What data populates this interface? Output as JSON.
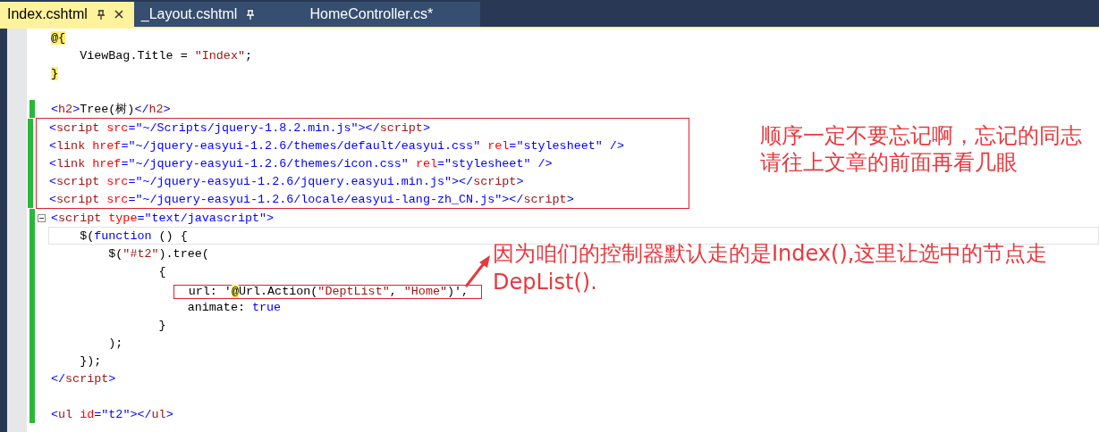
{
  "tabs": [
    {
      "label": "Index.cshtml",
      "selected": true,
      "pinned": true
    },
    {
      "label": "_Layout.cshtml",
      "selected": false,
      "pinned": true
    },
    {
      "label": "HomeController.cs*",
      "selected": false,
      "pinned": false
    }
  ],
  "sections": [
    {
      "boxed": false,
      "lines": [
        {
          "kind": "code",
          "changed": false,
          "current": false,
          "marked": false,
          "tokens": [
            {
              "kind": "razor",
              "text": "@{"
            }
          ]
        },
        {
          "kind": "code",
          "changed": false,
          "current": false,
          "marked": false,
          "tokens": [
            {
              "kind": "plain",
              "text": "    ViewBag.Title = "
            },
            {
              "kind": "string",
              "text": "\"Index\""
            },
            {
              "kind": "plain",
              "text": ";"
            }
          ]
        },
        {
          "kind": "code",
          "changed": false,
          "current": false,
          "marked": false,
          "tokens": [
            {
              "kind": "razor",
              "text": "}"
            }
          ]
        },
        {
          "kind": "blank",
          "changed": false,
          "current": false,
          "marked": false
        },
        {
          "kind": "code",
          "changed": true,
          "current": false,
          "marked": false,
          "tokens": [
            {
              "kind": "delim",
              "text": "<"
            },
            {
              "kind": "tag",
              "text": "h2"
            },
            {
              "kind": "delim",
              "text": ">"
            },
            {
              "kind": "plain",
              "text": "Tree(树)"
            },
            {
              "kind": "delim",
              "text": "</"
            },
            {
              "kind": "tag",
              "text": "h2"
            },
            {
              "kind": "delim",
              "text": ">"
            }
          ]
        }
      ]
    },
    {
      "boxed": true,
      "lines": [
        {
          "kind": "code",
          "changed": true,
          "current": false,
          "marked": false,
          "tokens": [
            {
              "kind": "delim",
              "text": "<"
            },
            {
              "kind": "tag",
              "text": "script"
            },
            {
              "kind": "attr",
              "text": " src"
            },
            {
              "kind": "delim",
              "text": "="
            },
            {
              "kind": "value",
              "text": "\"~/Scripts/jquery-1.8.2.min.js\""
            },
            {
              "kind": "delim",
              "text": "></"
            },
            {
              "kind": "tag",
              "text": "script"
            },
            {
              "kind": "delim",
              "text": ">"
            }
          ]
        },
        {
          "kind": "code",
          "changed": true,
          "current": false,
          "marked": false,
          "tokens": [
            {
              "kind": "delim",
              "text": "<"
            },
            {
              "kind": "tag",
              "text": "link"
            },
            {
              "kind": "attr",
              "text": " href"
            },
            {
              "kind": "delim",
              "text": "="
            },
            {
              "kind": "value",
              "text": "\"~/jquery-easyui-1.2.6/themes/default/easyui.css\""
            },
            {
              "kind": "attr",
              "text": " rel"
            },
            {
              "kind": "delim",
              "text": "="
            },
            {
              "kind": "value",
              "text": "\"stylesheet\""
            },
            {
              "kind": "delim",
              "text": " />"
            }
          ]
        },
        {
          "kind": "code",
          "changed": true,
          "current": false,
          "marked": false,
          "tokens": [
            {
              "kind": "delim",
              "text": "<"
            },
            {
              "kind": "tag",
              "text": "link"
            },
            {
              "kind": "attr",
              "text": " href"
            },
            {
              "kind": "delim",
              "text": "="
            },
            {
              "kind": "value",
              "text": "\"~/jquery-easyui-1.2.6/themes/icon.css\""
            },
            {
              "kind": "attr",
              "text": " rel"
            },
            {
              "kind": "delim",
              "text": "="
            },
            {
              "kind": "value",
              "text": "\"stylesheet\""
            },
            {
              "kind": "delim",
              "text": " />"
            }
          ]
        },
        {
          "kind": "code",
          "changed": true,
          "current": false,
          "marked": false,
          "tokens": [
            {
              "kind": "delim",
              "text": "<"
            },
            {
              "kind": "tag",
              "text": "script"
            },
            {
              "kind": "attr",
              "text": " src"
            },
            {
              "kind": "delim",
              "text": "="
            },
            {
              "kind": "value",
              "text": "\"~/jquery-easyui-1.2.6/jquery.easyui.min.js\""
            },
            {
              "kind": "delim",
              "text": "></"
            },
            {
              "kind": "tag",
              "text": "script"
            },
            {
              "kind": "delim",
              "text": ">"
            }
          ]
        },
        {
          "kind": "code",
          "changed": true,
          "current": false,
          "marked": false,
          "tokens": [
            {
              "kind": "delim",
              "text": "<"
            },
            {
              "kind": "tag",
              "text": "script"
            },
            {
              "kind": "attr",
              "text": " src"
            },
            {
              "kind": "delim",
              "text": "="
            },
            {
              "kind": "value",
              "text": "\"~/jquery-easyui-1.2.6/locale/easyui-lang-zh_CN.js\""
            },
            {
              "kind": "delim",
              "text": "></"
            },
            {
              "kind": "tag",
              "text": "script"
            },
            {
              "kind": "delim",
              "text": ">"
            }
          ]
        }
      ]
    },
    {
      "boxed": false,
      "lines": [
        {
          "kind": "fold",
          "changed": true,
          "current": false,
          "marked": false,
          "tokens": [
            {
              "kind": "delim",
              "text": "<"
            },
            {
              "kind": "tag",
              "text": "script"
            },
            {
              "kind": "attr",
              "text": " type"
            },
            {
              "kind": "delim",
              "text": "="
            },
            {
              "kind": "value",
              "text": "\"text/javascript\""
            },
            {
              "kind": "delim",
              "text": ">"
            }
          ]
        },
        {
          "kind": "code",
          "changed": true,
          "current": true,
          "marked": false,
          "tokens": [
            {
              "kind": "plain",
              "text": "    $("
            },
            {
              "kind": "keyword",
              "text": "function"
            },
            {
              "kind": "plain",
              "text": " () {"
            }
          ]
        },
        {
          "kind": "code",
          "changed": true,
          "current": false,
          "marked": false,
          "tokens": [
            {
              "kind": "plain",
              "text": "        $("
            },
            {
              "kind": "string",
              "text": "\"#t2\""
            },
            {
              "kind": "plain",
              "text": ").tree("
            }
          ]
        },
        {
          "kind": "code",
          "changed": true,
          "current": false,
          "marked": false,
          "tokens": [
            {
              "kind": "plain",
              "text": "               {"
            }
          ]
        },
        {
          "kind": "framed",
          "changed": true,
          "current": false,
          "marked": true,
          "tokens": [
            {
              "kind": "plain",
              "text": "  url: '"
            },
            {
              "kind": "razor",
              "text": "@"
            },
            {
              "kind": "plain",
              "text": "Url.Action("
            },
            {
              "kind": "string",
              "text": "\"DeptList\""
            },
            {
              "kind": "plain",
              "text": ", "
            },
            {
              "kind": "string",
              "text": "\"Home\""
            },
            {
              "kind": "plain",
              "text": ")',"
            }
          ]
        },
        {
          "kind": "code",
          "changed": true,
          "current": false,
          "marked": false,
          "tokens": [
            {
              "kind": "plain",
              "text": "                   animate: "
            },
            {
              "kind": "keyword",
              "text": "true"
            }
          ]
        },
        {
          "kind": "code",
          "changed": true,
          "current": false,
          "marked": false,
          "tokens": [
            {
              "kind": "plain",
              "text": "               }"
            }
          ]
        },
        {
          "kind": "code",
          "changed": true,
          "current": false,
          "marked": false,
          "tokens": [
            {
              "kind": "plain",
              "text": "        );"
            }
          ]
        },
        {
          "kind": "code",
          "changed": true,
          "current": false,
          "marked": false,
          "tokens": [
            {
              "kind": "plain",
              "text": "    });"
            }
          ]
        },
        {
          "kind": "code",
          "changed": true,
          "current": false,
          "marked": false,
          "tokens": [
            {
              "kind": "delim",
              "text": "</"
            },
            {
              "kind": "tag",
              "text": "script"
            },
            {
              "kind": "delim",
              "text": ">"
            }
          ]
        },
        {
          "kind": "blank",
          "changed": true,
          "current": false,
          "marked": false
        },
        {
          "kind": "code",
          "changed": true,
          "current": false,
          "marked": false,
          "tokens": [
            {
              "kind": "delim",
              "text": "<"
            },
            {
              "kind": "tag",
              "text": "ul"
            },
            {
              "kind": "attr",
              "text": " id"
            },
            {
              "kind": "delim",
              "text": "="
            },
            {
              "kind": "value",
              "text": "\"t2\""
            },
            {
              "kind": "delim",
              "text": "></"
            },
            {
              "kind": "tag",
              "text": "ul"
            },
            {
              "kind": "delim",
              "text": ">"
            }
          ]
        }
      ]
    }
  ],
  "notes": [
    {
      "kind": "order",
      "text": "顺序一定不要忘记啊，忘记的同志请往上文章的前面再看几眼"
    },
    {
      "kind": "controller",
      "text": "因为咱们的控制器默认走的是Index(),这里让选中的节点走DepList()."
    }
  ]
}
